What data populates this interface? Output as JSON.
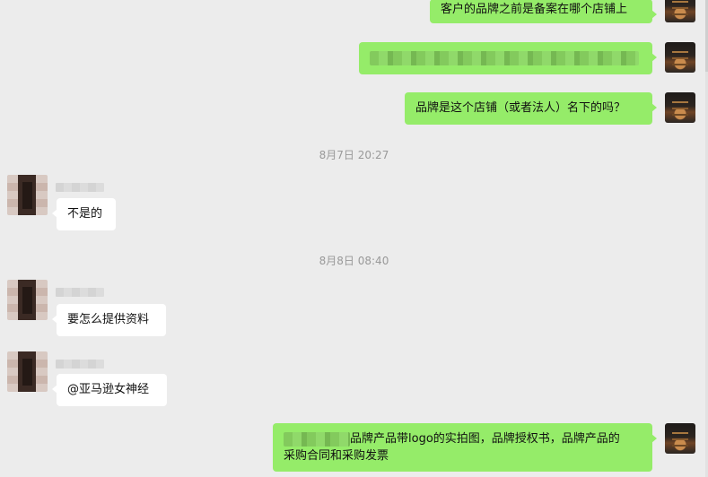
{
  "messages": {
    "m1": "客户的品牌之前是备案在哪个店铺上",
    "m3": "品牌是这个店铺（或者法人）名下的吗？",
    "ts1": "8月7日 20:27",
    "m4": "不是的",
    "ts2": "8月8日 08:40",
    "m5": "要怎么提供资料",
    "m6": "@亚马逊女神经",
    "m7_line1": "品牌产品带logo的实拍图，品牌授权书，品牌产品的",
    "m7_line2": "采购合同和采购发票"
  }
}
